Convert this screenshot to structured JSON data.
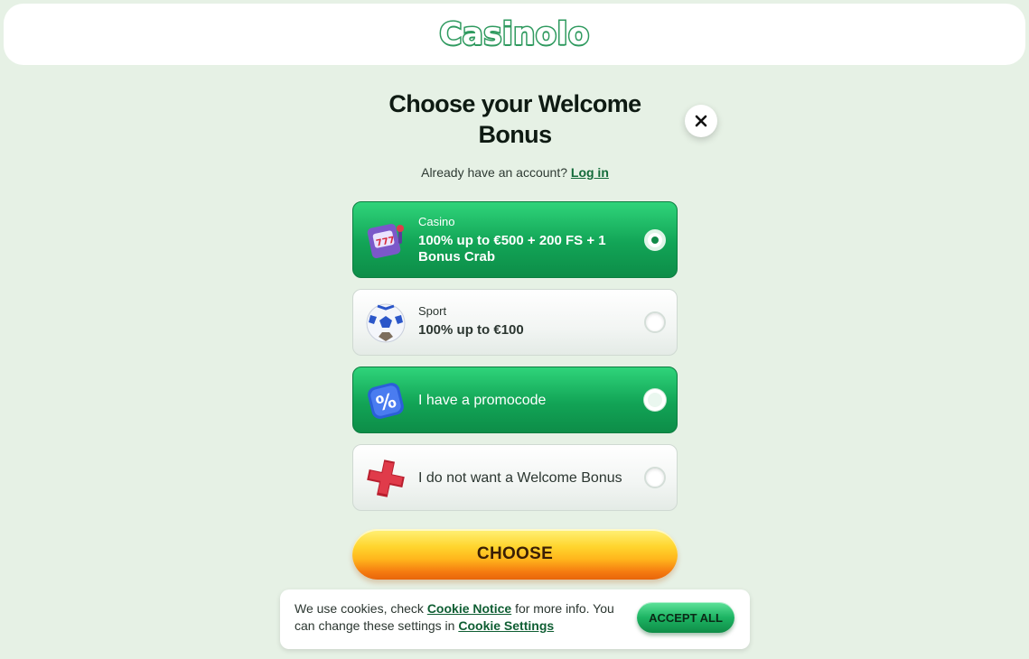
{
  "header": {
    "logo_text": "Casinolo"
  },
  "modal": {
    "title": "Choose your Welcome Bonus",
    "account_prompt": "Already have an account?",
    "login_link": "Log in"
  },
  "options": [
    {
      "label": "Casino",
      "value": "100% up to €500 + 200 FS + 1 Bonus Crab",
      "selected": true,
      "icon": "slot-machine-icon"
    },
    {
      "label": "Sport",
      "value": "100% up to €100",
      "selected": false,
      "icon": "soccer-ball-icon"
    },
    {
      "label": "I have a promocode",
      "selected": false,
      "icon": "percent-badge-icon"
    },
    {
      "label": "I do not want a Welcome Bonus",
      "selected": false,
      "icon": "red-cross-icon"
    }
  ],
  "choose_button": "CHOOSE",
  "cookie": {
    "text_before": "We use cookies, check",
    "notice_link": "Cookie Notice",
    "text_middle": "for more info. You can change these settings in",
    "settings_link": "Cookie Settings",
    "accept_button": "ACCEPT ALL"
  },
  "colors": {
    "background": "#e6f1e5",
    "brand_green": "#12a456",
    "cta_orange": "#ffb51c"
  }
}
